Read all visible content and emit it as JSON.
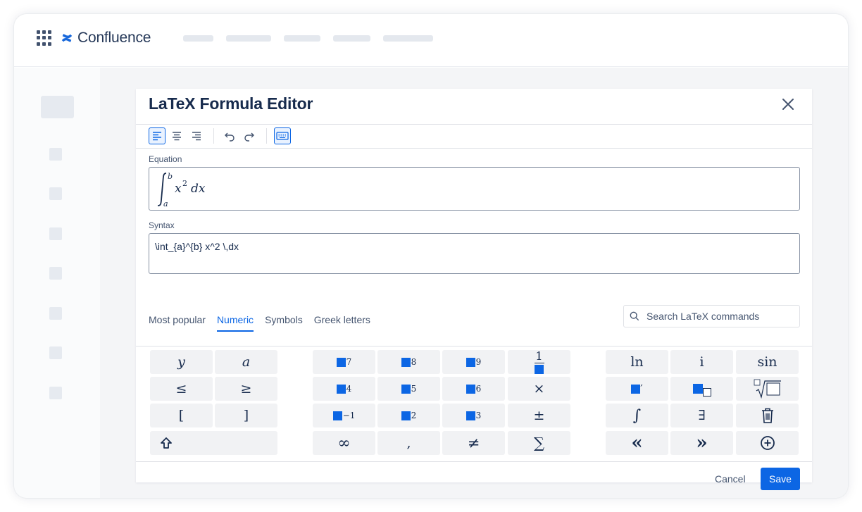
{
  "brand": {
    "name": "Confluence",
    "logo_icon": "confluence-logo-icon",
    "color": "#1868db"
  },
  "dialog": {
    "title": "LaTeX Formula Editor",
    "close_icon": "close-icon",
    "toolbar": {
      "buttons": [
        {
          "name": "align-left-icon",
          "active": true
        },
        {
          "name": "align-center-icon",
          "active": false
        },
        {
          "name": "align-right-icon",
          "active": false
        },
        {
          "name": "undo-icon",
          "active": false
        },
        {
          "name": "redo-icon",
          "active": false
        },
        {
          "name": "keyboard-icon",
          "active": true
        }
      ]
    },
    "equation_label": "Equation",
    "equation_preview": {
      "lower": "a",
      "upper": "b",
      "body": "x",
      "exp": "2",
      "dx": "dx"
    },
    "syntax_label": "Syntax",
    "syntax_value": "\\int_{a}^{b} x^2 \\,dx",
    "tabs": [
      "Most popular",
      "Numeric",
      "Symbols",
      "Greek letters"
    ],
    "active_tab": "Numeric",
    "search_placeholder": "Search LaTeX commands",
    "keys": {
      "left": [
        "y",
        "a",
        "≤",
        "≥",
        "[",
        "]",
        "shift-icon"
      ],
      "middle_superscripts": [
        "7",
        "8",
        "9",
        "4",
        "5",
        "6",
        "−1",
        "2",
        "3"
      ],
      "fraction_numerator": "1",
      "operators": [
        "×",
        "±",
        "∑"
      ],
      "bottom": [
        "∞",
        ",",
        "≠"
      ],
      "right": [
        "ln",
        "i",
        "sin",
        "′",
        "∫",
        "∃",
        "trash-icon",
        "«",
        "»",
        "plus-circle-icon"
      ]
    },
    "cancel_label": "Cancel",
    "save_label": "Save"
  },
  "colors": {
    "accent": "#0c66e4",
    "text": "#172b4d",
    "key_bg": "#f1f2f4"
  }
}
